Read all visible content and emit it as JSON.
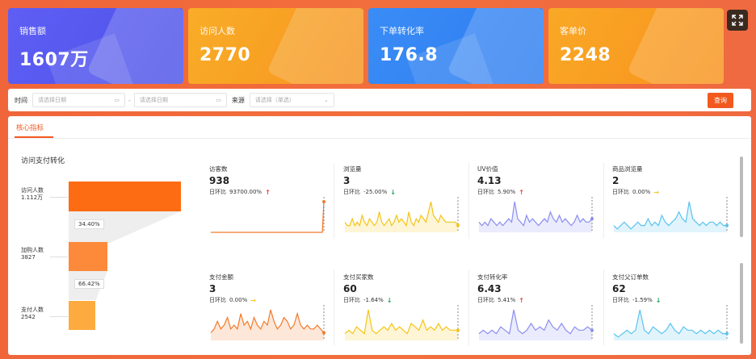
{
  "kpis": [
    {
      "title": "销售额",
      "value": "1607万"
    },
    {
      "title": "访问人数",
      "value": "2770"
    },
    {
      "title": "下单转化率",
      "value": "176.8"
    },
    {
      "title": "客单价",
      "value": "2248"
    }
  ],
  "filter": {
    "time_label": "时间",
    "start_placeholder": "请选择日期",
    "end_placeholder": "请选择日期",
    "source_label": "来源",
    "source_placeholder": "请选择（单选）",
    "search_label": "查询"
  },
  "tab": {
    "label": "核心指标"
  },
  "funnel": {
    "title": "访问支付转化",
    "stages": [
      {
        "name": "访问人数",
        "value": "1.112万"
      },
      {
        "name": "加购人数",
        "value": "3827"
      },
      {
        "name": "支付人数",
        "value": "2542"
      }
    ],
    "rates": [
      "34.40%",
      "66.42%"
    ]
  },
  "compare_label": "日环比",
  "metrics": [
    {
      "title": "访客数",
      "value": "938",
      "change": "93700.00%",
      "trend": "up",
      "color": "#f27a2a",
      "series": [
        0,
        0,
        0,
        0,
        0,
        0,
        0,
        0,
        0,
        0,
        0,
        0,
        0,
        0,
        0,
        0,
        0,
        0,
        0,
        0,
        0,
        0,
        0,
        0,
        0,
        0,
        0,
        0,
        0,
        0,
        0,
        0,
        0,
        0,
        0,
        0,
        0,
        0,
        0,
        0,
        0,
        0,
        0,
        0,
        0,
        0,
        0,
        0,
        0,
        0,
        0,
        0,
        0,
        0,
        0,
        0,
        0,
        0,
        0,
        0,
        0,
        0,
        0,
        0,
        0,
        0,
        0,
        0,
        0,
        0,
        0,
        1
      ]
    },
    {
      "title": "浏览量",
      "value": "3",
      "change": "-25.00%",
      "trend": "down",
      "color": "#f5c518",
      "series": [
        3,
        2,
        2,
        4,
        2,
        3,
        2,
        5,
        3,
        2,
        4,
        3,
        2,
        3,
        6,
        3,
        2,
        3,
        4,
        2,
        3,
        5,
        3,
        4,
        3,
        2,
        6,
        3,
        2,
        4,
        3,
        5,
        4,
        3,
        6,
        9,
        5,
        4,
        3,
        5,
        4,
        3,
        3,
        3,
        3,
        3,
        2
      ]
    },
    {
      "title": "UV价值",
      "value": "4.13",
      "change": "5.90%",
      "trend": "up",
      "color": "#8c8ff0",
      "series": [
        3,
        2,
        3,
        2,
        4,
        3,
        2,
        3,
        2,
        3,
        4,
        3,
        9,
        4,
        3,
        2,
        5,
        3,
        4,
        3,
        2,
        3,
        4,
        3,
        6,
        4,
        3,
        5,
        3,
        4,
        3,
        2,
        3,
        5,
        3,
        4,
        3,
        3,
        4
      ]
    },
    {
      "title": "商品浏览量",
      "value": "2",
      "change": "0.00%",
      "trend": "flat",
      "color": "#5bc3ef",
      "series": [
        2,
        1,
        2,
        3,
        2,
        1,
        2,
        3,
        2,
        2,
        4,
        2,
        3,
        2,
        5,
        3,
        2,
        3,
        4,
        6,
        4,
        3,
        9,
        4,
        3,
        2,
        3,
        2,
        3,
        3,
        2,
        3,
        2,
        2
      ]
    },
    {
      "title": "支付金额",
      "value": "3",
      "change": "0.00%",
      "trend": "flat",
      "color": "#f27a2a",
      "series": [
        2,
        3,
        5,
        3,
        4,
        6,
        3,
        4,
        3,
        7,
        4,
        5,
        3,
        6,
        4,
        3,
        5,
        4,
        8,
        5,
        3,
        4,
        6,
        5,
        3,
        4,
        7,
        4,
        3,
        4,
        3,
        3,
        4,
        3,
        2
      ]
    },
    {
      "title": "支付买家数",
      "value": "60",
      "change": "-1.64%",
      "trend": "down",
      "color": "#f5c518",
      "series": [
        2,
        3,
        2,
        4,
        3,
        2,
        9,
        3,
        2,
        3,
        4,
        3,
        5,
        3,
        4,
        3,
        2,
        5,
        4,
        3,
        6,
        3,
        4,
        3,
        5,
        3,
        4,
        3,
        3,
        3
      ]
    },
    {
      "title": "支付转化率",
      "value": "6.43",
      "change": "5.41%",
      "trend": "up",
      "color": "#8c8ff0",
      "series": [
        2,
        3,
        2,
        3,
        2,
        4,
        3,
        2,
        9,
        3,
        2,
        3,
        5,
        3,
        4,
        3,
        6,
        4,
        3,
        5,
        3,
        2,
        4,
        3,
        3,
        4,
        3
      ]
    },
    {
      "title": "支付父订单数",
      "value": "62",
      "change": "-1.59%",
      "trend": "down",
      "color": "#5bc3ef",
      "series": [
        2,
        1,
        2,
        3,
        2,
        3,
        9,
        3,
        2,
        4,
        3,
        2,
        3,
        5,
        3,
        2,
        4,
        3,
        3,
        2,
        3,
        2,
        3,
        2,
        3,
        2,
        2
      ]
    }
  ]
}
